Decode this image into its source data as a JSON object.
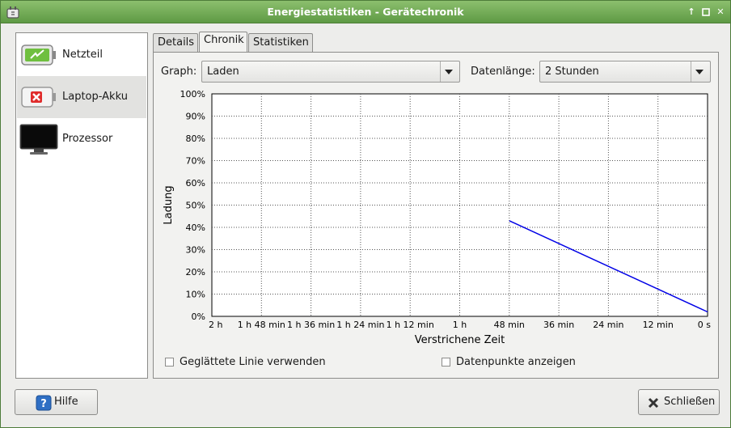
{
  "window": {
    "title": "Energiestatistiken - Gerätechronik"
  },
  "sidebar": {
    "items": [
      {
        "label": "Netzteil",
        "icon": "ac-adapter-icon"
      },
      {
        "label": "Laptop-Akku",
        "icon": "battery-missing-icon"
      },
      {
        "label": "Prozessor",
        "icon": "monitor-icon"
      }
    ],
    "selected": "Laptop-Akku"
  },
  "tabs": [
    {
      "label": "Details"
    },
    {
      "label": "Chronik"
    },
    {
      "label": "Statistiken"
    }
  ],
  "active_tab": "Chronik",
  "controls": {
    "graph_label": "Graph:",
    "graph_value": "Laden",
    "length_label": "Datenlänge:",
    "length_value": "2 Stunden"
  },
  "options": {
    "smooth_label": "Geglättete Linie verwenden",
    "points_label": "Datenpunkte anzeigen"
  },
  "buttons": {
    "help": "Hilfe",
    "close": "Schließen"
  },
  "colors": {
    "titlebar": "#6fa553",
    "series": "#0000e6"
  },
  "chart_data": {
    "type": "line",
    "xlabel": "Verstrichene Zeit",
    "ylabel": "Ladung",
    "x_ticks": [
      "2 h",
      "1 h 48 min",
      "1 h 36 min",
      "1 h 24 min",
      "1 h 12 min",
      "1 h",
      "48 min",
      "36 min",
      "24 min",
      "12 min",
      "0 s"
    ],
    "y_ticks": [
      "0%",
      "10%",
      "20%",
      "30%",
      "40%",
      "50%",
      "60%",
      "70%",
      "80%",
      "90%",
      "100%"
    ],
    "xlim_minutes_elapsed": [
      0,
      120
    ],
    "ylim": [
      0,
      100
    ],
    "grid": true,
    "series": [
      {
        "points": [
          {
            "x_min": 72,
            "y": 43
          },
          {
            "x_min": 120,
            "y": 2
          }
        ]
      }
    ]
  }
}
